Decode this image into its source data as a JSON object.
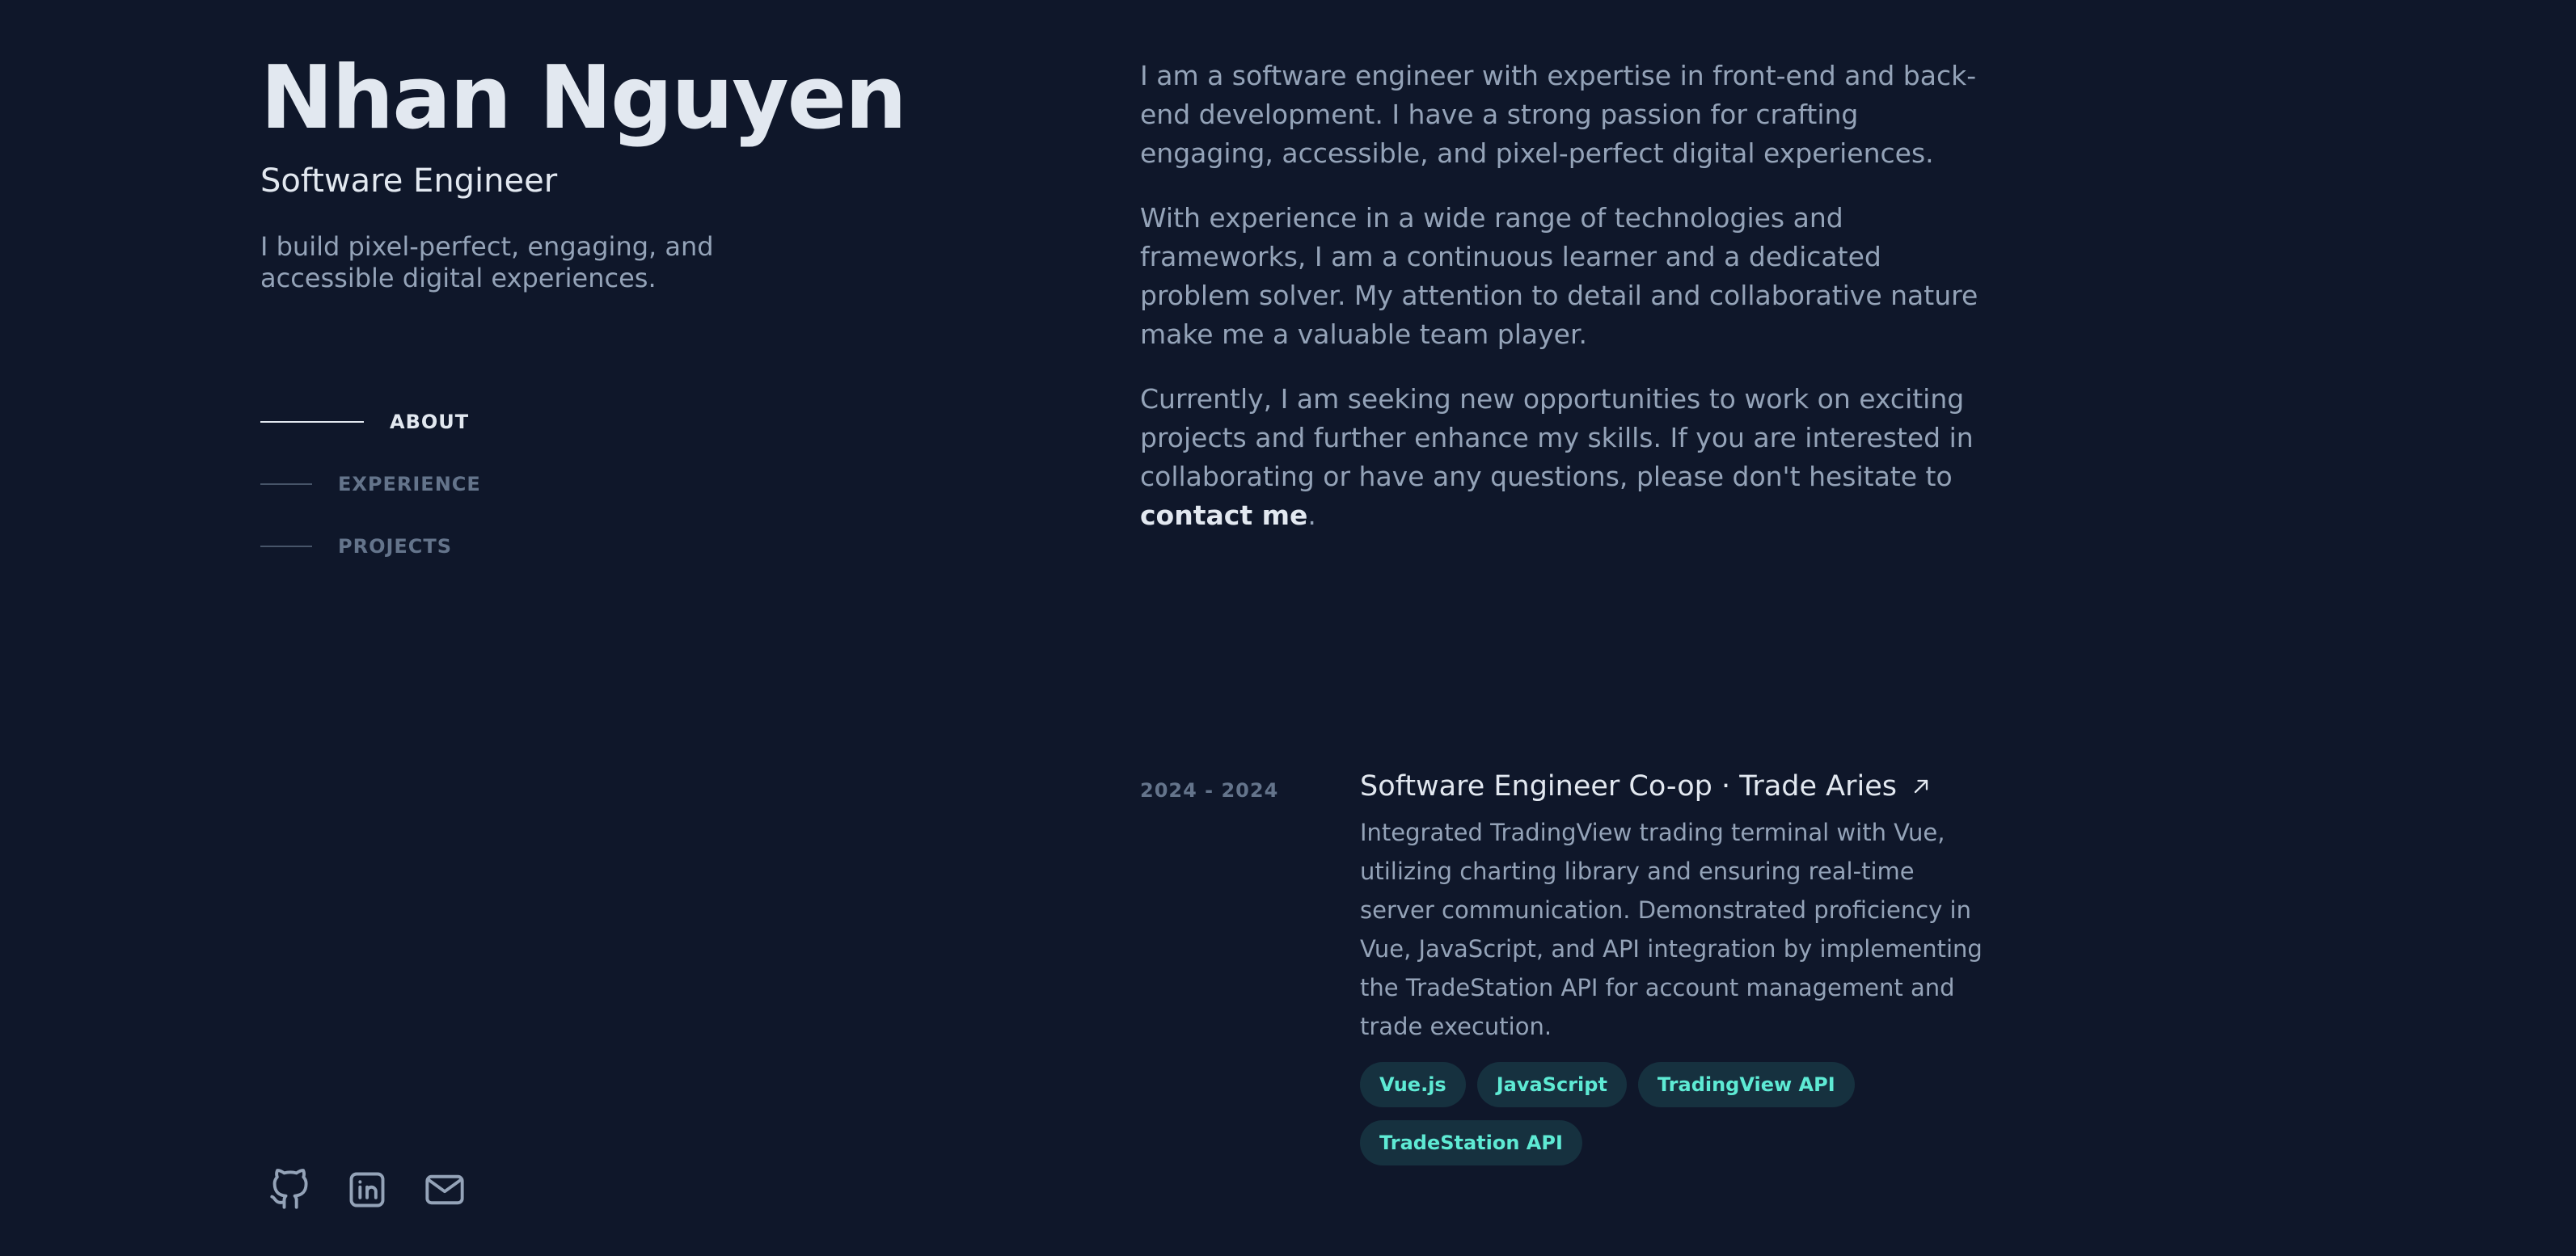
{
  "header": {
    "name": "Nhan Nguyen",
    "role": "Software Engineer",
    "tagline": "I build pixel-perfect, engaging, and accessible digital experiences."
  },
  "nav": {
    "items": [
      {
        "label": "ABOUT",
        "active": true
      },
      {
        "label": "EXPERIENCE",
        "active": false
      },
      {
        "label": "PROJECTS",
        "active": false
      }
    ]
  },
  "socials": {
    "icons": [
      "github-icon",
      "linkedin-icon",
      "mail-icon"
    ]
  },
  "about": {
    "p1": "I am a software engineer with expertise in front-end and back-end development. I have a strong passion for crafting engaging, accessible, and pixel-perfect digital experiences.",
    "p2": "With experience in a wide range of technologies and frameworks, I am a continuous learner and a dedicated problem solver. My attention to detail and collaborative nature make me a valuable team player.",
    "p3": "Currently, I am seeking new opportunities to work on exciting projects and further enhance my skills. If you are interested in collaborating or have any questions, please don't hesitate to",
    "contact_link": "contact me",
    "p3_end": "."
  },
  "experience": {
    "items": [
      {
        "date": "2024 - 2024",
        "title": "Software Engineer Co-op · Trade Aries",
        "description": "Integrated TradingView trading terminal with Vue, utilizing charting library and ensuring real-time server communication. Demonstrated proficiency in Vue, JavaScript, and API integration by implementing the TradeStation API for account management and trade execution.",
        "tags": [
          "Vue.js",
          "JavaScript",
          "TradingView API",
          "TradeStation API"
        ]
      }
    ]
  },
  "colors": {
    "background": "#0f172a",
    "heading": "#e2e8f0",
    "body_text": "#94a3b8",
    "muted": "#64748b",
    "accent": "#5eead4",
    "tag_bg": "#16313f"
  }
}
